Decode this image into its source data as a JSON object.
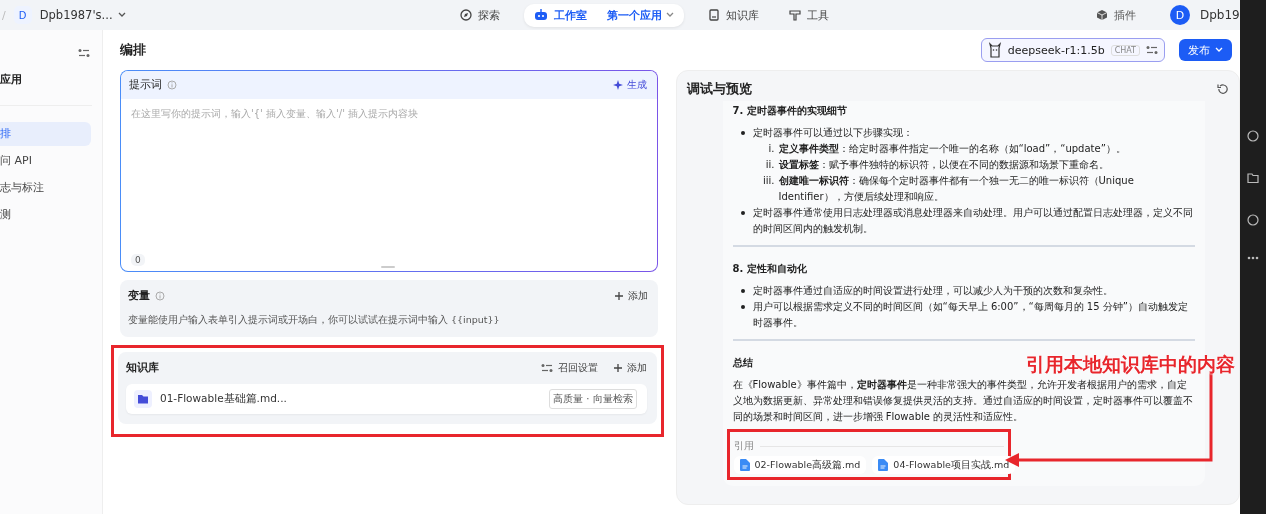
{
  "top_bar": {
    "breadcrumb_separator": "/",
    "workspace": {
      "avatar": "D",
      "name": "Dpb1987's..."
    },
    "nav": [
      {
        "kind": "link",
        "label": "探索",
        "selected": false
      },
      {
        "kind": "pill",
        "label": "工作室",
        "app": "第一个应用",
        "selected": true
      },
      {
        "kind": "link",
        "label": "知识库",
        "selected": false
      },
      {
        "kind": "link",
        "label": "工具",
        "selected": false
      }
    ],
    "plugins": "插件",
    "user": {
      "avatar": "D",
      "name": "Dpb19"
    }
  },
  "sidebar": {
    "app_title": "应用",
    "items": [
      {
        "label": "排",
        "selected": true
      },
      {
        "label": "问 API",
        "selected": false
      },
      {
        "label": "志与标注",
        "selected": false
      },
      {
        "label": "测",
        "selected": false
      }
    ]
  },
  "editor": {
    "title": "编排",
    "model": {
      "name": "deepseek-r1:1.5b",
      "tag": "CHAT"
    },
    "publish": "发布",
    "prompt": {
      "title": "提示词",
      "generate": "生成",
      "placeholder": "在这里写你的提示词，输入'{' 插入变量、输入'/' 插入提示内容块",
      "count": "0"
    },
    "variables": {
      "title": "变量",
      "add": "添加",
      "description": "变量能使用户输入表单引入提示词或开场白，你可以试试在提示词中输入 {{input}}"
    },
    "knowledge": {
      "title": "知识库",
      "settings": "召回设置",
      "add": "添加",
      "items": [
        {
          "name": "01-Flowable基础篇.md...",
          "badge": "高质量 · 向量检索"
        }
      ]
    }
  },
  "preview": {
    "title": "调试与预览",
    "blocks": [
      {
        "kind": "heading",
        "text": "7. 定时器事件的实现细节"
      },
      {
        "kind": "bullets",
        "items": [
          {
            "text": "定时器事件可以通过以下步骤实现：",
            "children": [
              {
                "marker": "i.",
                "text": "**定义事件类型**：给定时器事件指定一个唯一的名称（如“load”，“update”）。"
              },
              {
                "marker": "ii.",
                "text": "**设置标签**：赋予事件独特的标识符，以便在不同的数据源和场景下重命名。"
              },
              {
                "marker": "iii.",
                "text": "**创建唯一标识符**：确保每个定时器事件都有一个独一无二的唯一标识符（Unique Identifier），方便后续处理和响应。"
              }
            ]
          },
          {
            "text": "定时器事件通常使用日志处理器或消息处理器来自动处理。用户可以通过配置日志处理器，定义不同的时间区间内的触发机制。"
          }
        ]
      },
      {
        "kind": "rule"
      },
      {
        "kind": "heading",
        "text": "8. 定性和自动化"
      },
      {
        "kind": "bullets",
        "items": [
          {
            "text": "定时器事件通过自适应的时间设置进行处理，可以减少人为干预的次数和复杂性。"
          },
          {
            "text": "用户可以根据需求定义不同的时间区间（如“每天早上 6:00”，“每周每月的 15 分钟”）自动触发定时器事件。"
          }
        ]
      },
      {
        "kind": "rule"
      },
      {
        "kind": "heading",
        "text": "总结"
      },
      {
        "kind": "paragraph",
        "text": "在《Flowable》事件篇中，**定时器事件**是一种非常强大的事件类型，允许开发者根据用户的需求，自定义地为数据更新、异常处理和错误修复提供灵活的支持。通过自适应的时间设置，定时器事件可以覆盖不同的场景和时间区间，进一步增强 Flowable 的灵活性和适应性。"
      }
    ],
    "citations": {
      "title": "引用",
      "items": [
        "02-Flowable高级篇.md",
        "04-Flowable项目实战.md"
      ]
    }
  },
  "annotation": {
    "text": "引用本地知识库中的内容"
  }
}
